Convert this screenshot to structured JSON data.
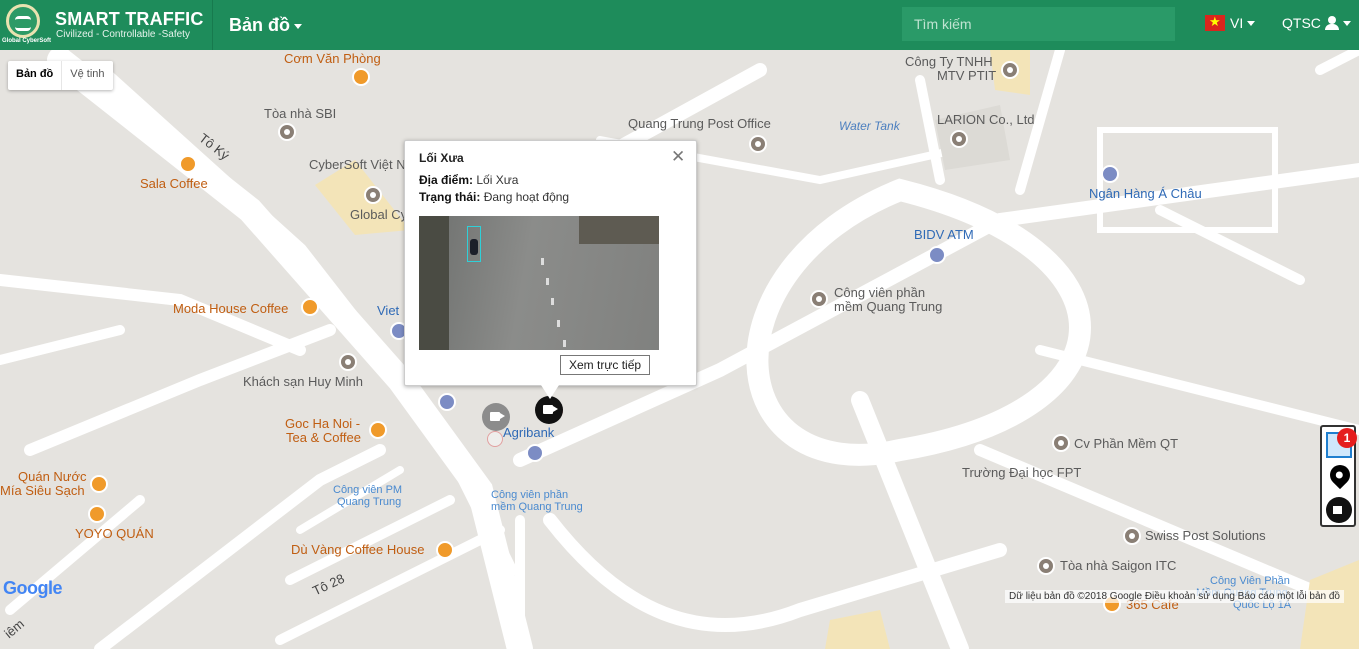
{
  "navbar": {
    "logo_sub": "Global CyberSoft",
    "title": "SMART TRAFFIC",
    "tagline": "Civilized - Controllable -Safety",
    "menu_map": "Bản đồ",
    "search_placeholder": "Tìm kiếm",
    "lang": "VI",
    "user": "QTSC"
  },
  "map_type": {
    "map": "Bản đồ",
    "satellite": "Vệ tinh"
  },
  "map_labels": {
    "com_van_phong": "Cơm Văn Phòng",
    "toa_nha_sbi": "Tòa nhà SBI",
    "cybersoft": "CyberSoft Việt N",
    "global_cy": "Global Cy",
    "sala_coffee": "Sala Coffee",
    "to_ky": "Tô Ký",
    "moda_house": "Moda House Coffee",
    "viet": "Viet",
    "khach_san": "Khách sạn Huy Minh",
    "goc_ha_noi_1": "Goc Ha Noi -",
    "goc_ha_noi_2": "Tea & Coffee",
    "quan_nuoc_1": "Quán Nước",
    "quan_nuoc_2": "Mía Siêu Sạch",
    "yoyo": "YOYO QUÁN",
    "du_vang": "Dù Vàng Coffee House",
    "to_28": "Tô 28",
    "cong_vien_pm_1": "Công viên PM",
    "cong_vien_pm_2": "Quang Trung",
    "cong_vien_phan_1": "Công viên phần",
    "cong_vien_phan_2": "mềm Quang Trung",
    "agribank": "Agribank",
    "cong_ty_1": "Công Ty TNHH",
    "cong_ty_2": "MTV PTIT",
    "post_office": "Quang Trung Post Office",
    "water_tank": "Water Tank",
    "larion": "LARION Co., Ltd",
    "ngan_hang": "Ngân Hàng Á Châu",
    "bidv": "BIDV ATM",
    "cv_mem_1": "Công viên phần",
    "cv_mem_2": "mềm Quang Trung",
    "cv_phan_mem_qt": "Cv Phần Mềm QT",
    "fpt": "Trường Đại học FPT",
    "swiss_post": "Swiss Post Solutions",
    "saigon_itc": "Tòa nhà Saigon ITC",
    "cv_qlo_1": "Công Viên Phần",
    "cv_qlo_2": "Mềm Quang Trung",
    "cv_qlo_3": "Quốc Lộ 1A",
    "cafe_365": "365 Cafe",
    "diem": "iêm"
  },
  "popup": {
    "title": "Lối Xưa",
    "location_label": "Địa điểm:",
    "location_value": "Lối Xưa",
    "status_label": "Trạng thái:",
    "status_value": "Đang hoạt động",
    "live_button": "Xem trực tiếp"
  },
  "side_panel": {
    "badge_count": "1"
  },
  "footer": {
    "google": "Google",
    "attribution": "Dữ liệu bản đồ ©2018 Google   Điều khoản sử dụng   Báo cáo một lỗi bản đồ"
  },
  "colors": {
    "navbar": "#1e8c5b",
    "active_camera": "#111111",
    "inactive_camera": "#8c8c8c",
    "badge": "#e51d1d"
  }
}
